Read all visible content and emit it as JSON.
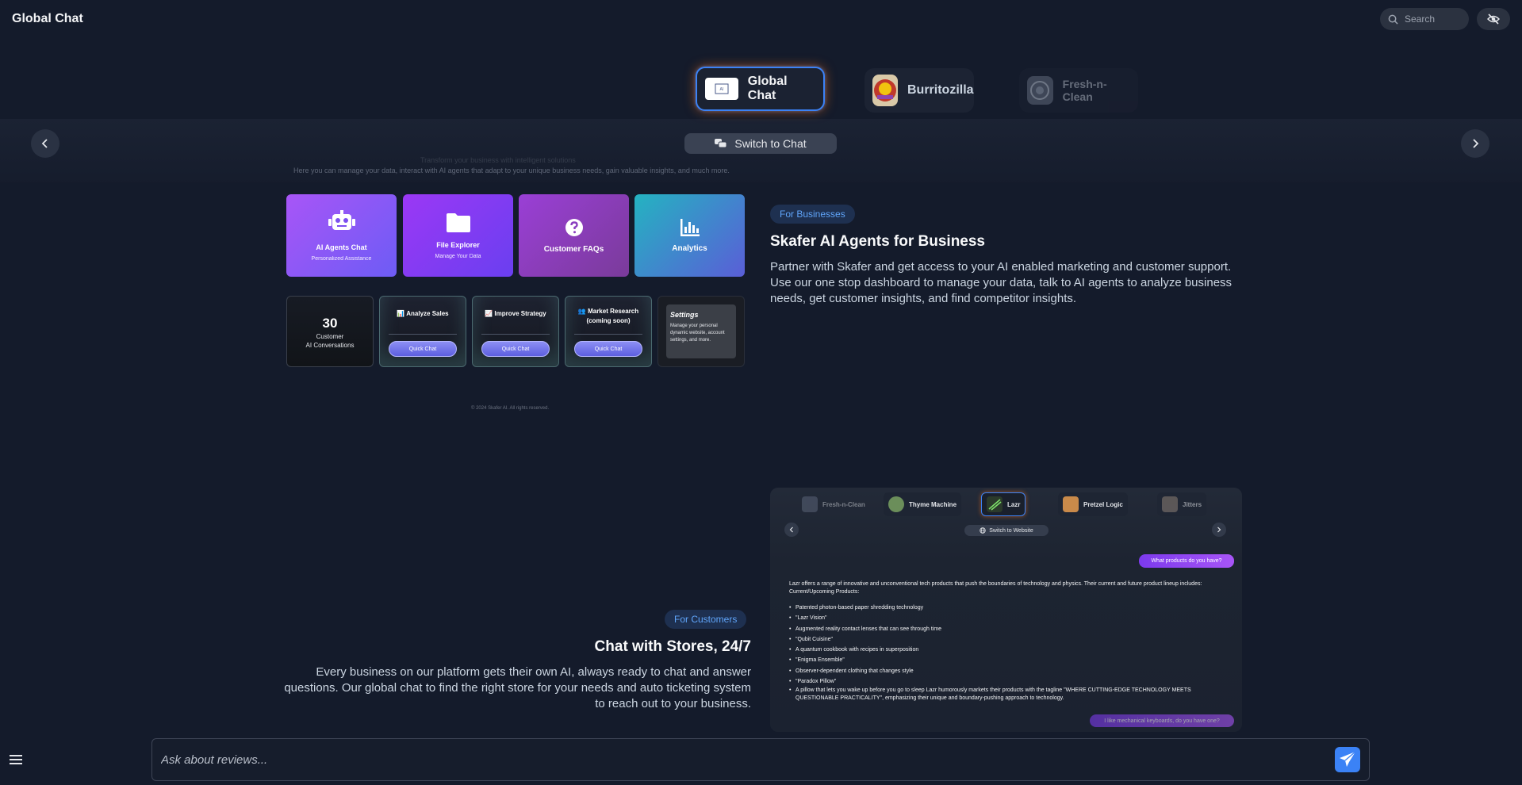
{
  "header": {
    "title": "Global Chat",
    "search_placeholder": "Search"
  },
  "carousel": {
    "stores": [
      {
        "name": "Global Chat",
        "active": true
      },
      {
        "name": "Burritozilla",
        "active": false
      },
      {
        "name": "Fresh-n-Clean",
        "active": false
      }
    ],
    "switch_label": "Switch to Chat"
  },
  "dashboard": {
    "intro_faded": "Transform your business with intelligent solutions",
    "intro": "Here you can manage your data, interact with AI agents that adapt to your unique business needs, gain valuable insights, and much more.",
    "tiles": [
      {
        "title": "AI Agents Chat",
        "subtitle": "Personalized Assistance",
        "icon": "robot-icon"
      },
      {
        "title": "File Explorer",
        "subtitle": "Manage Your Data",
        "icon": "folder-icon"
      },
      {
        "title": "Customer FAQs",
        "subtitle": "",
        "icon": "question-icon"
      },
      {
        "title": "Analytics",
        "subtitle": "",
        "icon": "chart-icon"
      }
    ],
    "stat": {
      "value": "30",
      "label1": "Customer",
      "label2": "AI Conversations"
    },
    "quick_cards": [
      {
        "title": "📊 Analyze Sales",
        "button": "Quick Chat"
      },
      {
        "title": "📈 Improve Strategy",
        "button": "Quick Chat"
      },
      {
        "title": "👥 Market Research",
        "title2": "(coming soon)",
        "button": "Quick Chat"
      }
    ],
    "settings": {
      "title": "Settings",
      "text": "Manage your personal dynamic website, account settings, and more."
    },
    "copyright": "© 2024 Skafer AI. All rights reserved."
  },
  "business": {
    "badge": "For Businesses",
    "title": "Skafer AI Agents for Business",
    "text": "Partner with Skafer and get access to your AI enabled marketing and customer support. Use our one stop dashboard to manage your data, talk to AI agents to analyze business needs, get customer insights, and find competitor insights."
  },
  "customers": {
    "badge": "For Customers",
    "title": "Chat with Stores, 24/7",
    "text": "Every business on our platform gets their own AI, always ready to chat and answer questions. Our global chat to find the right store for your needs and auto ticketing system to reach out to your business."
  },
  "chat_preview": {
    "stores": [
      "Fresh-n-Clean",
      "Thyme Machine",
      "Lazr",
      "Pretzel Logic",
      "Jitters"
    ],
    "switch_label": "Switch to Website",
    "user_msg": "What products do you have?",
    "reply_intro": "Lazr offers a range of innovative and unconventional tech products that push the boundaries of technology and physics. Their current and future product lineup includes: Current/Upcoming Products:",
    "items": [
      "Patented photon-based paper shredding technology",
      "\"Lazr Vision\"",
      "Augmented reality contact lenses that can see through time",
      "\"Qubit Cuisine\"",
      "A quantum cookbook with recipes in superposition",
      "\"Enigma Ensemble\"",
      "Observer-dependent clothing that changes style",
      "\"Paradox Pillow\"",
      "A pillow that lets you wake up before you go to sleep Lazr humorously markets their products with the tagline \"WHERE CUTTING-EDGE TECHNOLOGY MEETS QUESTIONABLE PRACTICALITY\", emphasizing their unique and boundary-pushing approach to technology."
    ],
    "user_msg2": "I like mechanical keyboards, do you have one?"
  },
  "composer": {
    "placeholder": "Ask about reviews..."
  }
}
